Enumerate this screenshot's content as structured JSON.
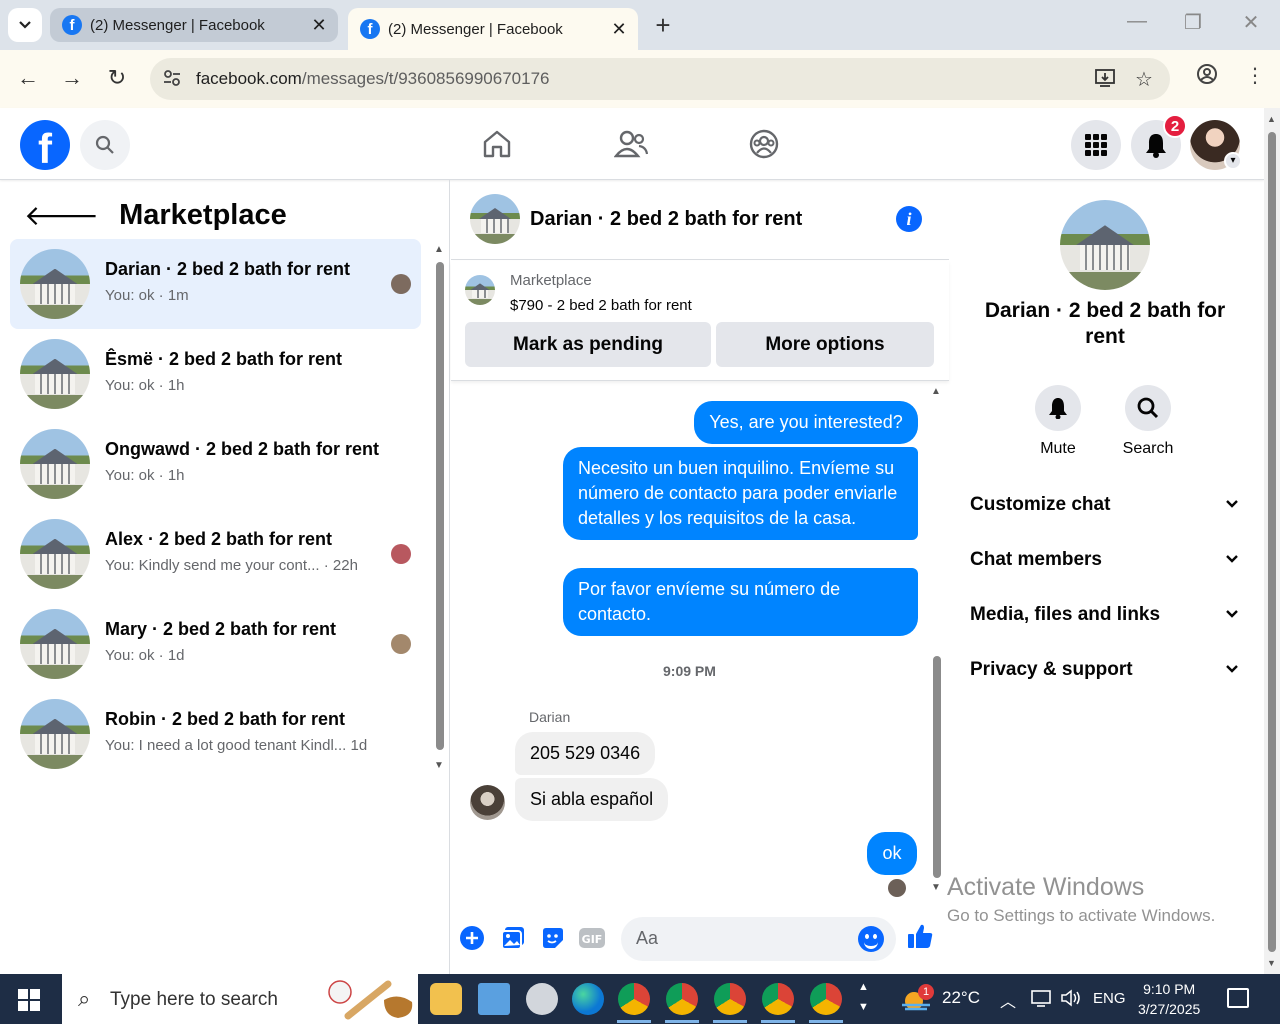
{
  "browser": {
    "tabs": [
      {
        "title": "(2) Messenger | Facebook",
        "active": false
      },
      {
        "title": "(2) Messenger | Facebook",
        "active": true
      }
    ],
    "url_domain": "facebook.com",
    "url_path": "/messages/t/9360856990670176"
  },
  "fb": {
    "notification_count": "2"
  },
  "left": {
    "heading": "Marketplace",
    "conversations": [
      {
        "name": "Darian · 2 bed 2 bath for rent",
        "preview": "You: ok · 1m",
        "selected": true
      },
      {
        "name": "Êsmë · 2 bed 2 bath for rent",
        "preview": "You: ok · 1h",
        "selected": false
      },
      {
        "name": "Ongwawd · 2 bed 2 bath for rent",
        "preview": "You: ok · 1h",
        "selected": false
      },
      {
        "name": "Alex · 2 bed 2 bath for rent",
        "preview": "You: Kindly send me your cont...  · 22h",
        "selected": false
      },
      {
        "name": "Mary · 2 bed 2 bath for rent",
        "preview": "You: ok · 1d",
        "selected": false
      },
      {
        "name": "Robin · 2 bed 2 bath for rent",
        "preview": "You: I need a lot good tenant Kindl...   1d",
        "selected": false
      }
    ]
  },
  "chat": {
    "title": "Darian · 2 bed 2 bath for rent",
    "listing": {
      "label": "Marketplace",
      "price_title": "$790 - 2 bed 2 bath for rent",
      "btn_pending": "Mark as pending",
      "btn_more": "More options"
    },
    "messages": {
      "m1": "Yes, are you interested?",
      "m2": "Necesito un buen inquilino. Envíeme su número de contacto para poder enviarle detalles y los requisitos de la casa.",
      "m3": "Por favor envíeme su número de contacto.",
      "time": "9:09 PM",
      "sender": "Darian",
      "in1": "205 529 0346",
      "in2": "Si abla español",
      "m4": "ok"
    },
    "composer_placeholder": "Aa"
  },
  "right": {
    "name": "Darian · 2 bed 2 bath for rent",
    "actions": {
      "mute": "Mute",
      "search": "Search"
    },
    "sections": [
      "Customize chat",
      "Chat members",
      "Media, files and links",
      "Privacy & support"
    ]
  },
  "watermark": {
    "line1": "Activate Windows",
    "line2": "Go to Settings to activate Windows."
  },
  "taskbar": {
    "search_placeholder": "Type here to search",
    "weather": "22°C",
    "weather_badge": "1",
    "language": "ENG",
    "time": "9:10 PM",
    "date": "3/27/2025"
  },
  "colors": {
    "fb_blue": "#0866ff",
    "messenger_bubble": "#0084ff",
    "selected_row": "#e7f0fd"
  }
}
